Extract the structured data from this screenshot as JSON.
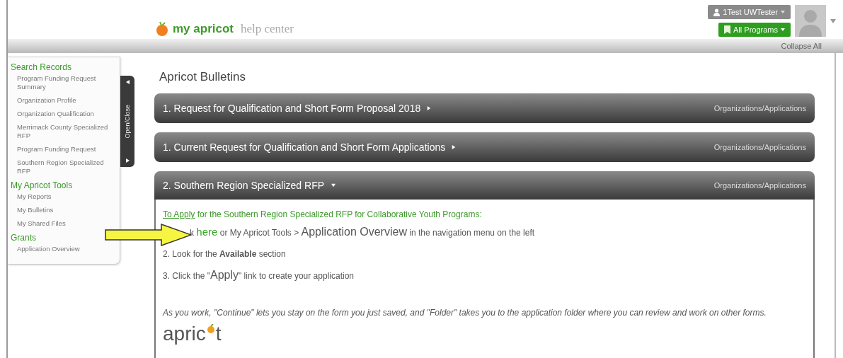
{
  "header": {
    "brand": "my apricot",
    "subtitle": "help center",
    "user_menu": "1Test UWTester",
    "program_menu": "All Programs",
    "collapse_all": "Collapse All"
  },
  "sidebar": {
    "toggle_label": "Open/Close",
    "sections": [
      {
        "title": "Search Records",
        "items": [
          "Program Funding Request Summary",
          "Organization Profile",
          "Organization Qualification",
          "Merrimack County Specialized RFP",
          "Program Funding Request",
          "Southern Region Specialized RFP"
        ]
      },
      {
        "title": "My Apricot Tools",
        "items": [
          "My Reports",
          "My Bulletins",
          "My Shared Files"
        ]
      },
      {
        "title": "Grants",
        "items": [
          "Application Overview"
        ]
      }
    ]
  },
  "main": {
    "title": "Apricot Bulletins",
    "bulletins": [
      {
        "title": "1. Request for Qualification and  Short Form Proposal 2018",
        "category": "Organizations/Applications",
        "expanded": false
      },
      {
        "title": "1. Current Request for Qualification and Short Form Applications",
        "category": "Organizations/Applications",
        "expanded": false
      },
      {
        "title": "2. Southern Region Specialized RFP",
        "category": "Organizations/Applications",
        "expanded": true,
        "body": {
          "intro_link": "To Apply",
          "intro": " for the Southern Region Specialized RFP for Collaborative Youth Programs:",
          "steps": [
            [
              {
                "kind": "plain",
                "text": "k "
              },
              {
                "kind": "link",
                "text": "here"
              },
              {
                "kind": "plain",
                "text": " or My Apricot Tools > "
              },
              {
                "kind": "large",
                "text": "Application Overview"
              },
              {
                "kind": "plain",
                "text": " in the navigation menu on the left"
              }
            ],
            [
              {
                "kind": "plain",
                "text": "2. Look for the "
              },
              {
                "kind": "bold",
                "text": "Available"
              },
              {
                "kind": "plain",
                "text": " section"
              }
            ],
            [
              {
                "kind": "plain",
                "text": "3. Click the \""
              },
              {
                "kind": "large",
                "text": "Apply"
              },
              {
                "kind": "plain",
                "text": "\" link to create your application"
              }
            ]
          ],
          "note": "As you work, \"Continue\" lets you stay on the form you just saved, and \"Folder\" takes you to the application folder where you can review and work on other forms.",
          "logo_head": "apric",
          "logo_tail": "t"
        }
      }
    ]
  }
}
